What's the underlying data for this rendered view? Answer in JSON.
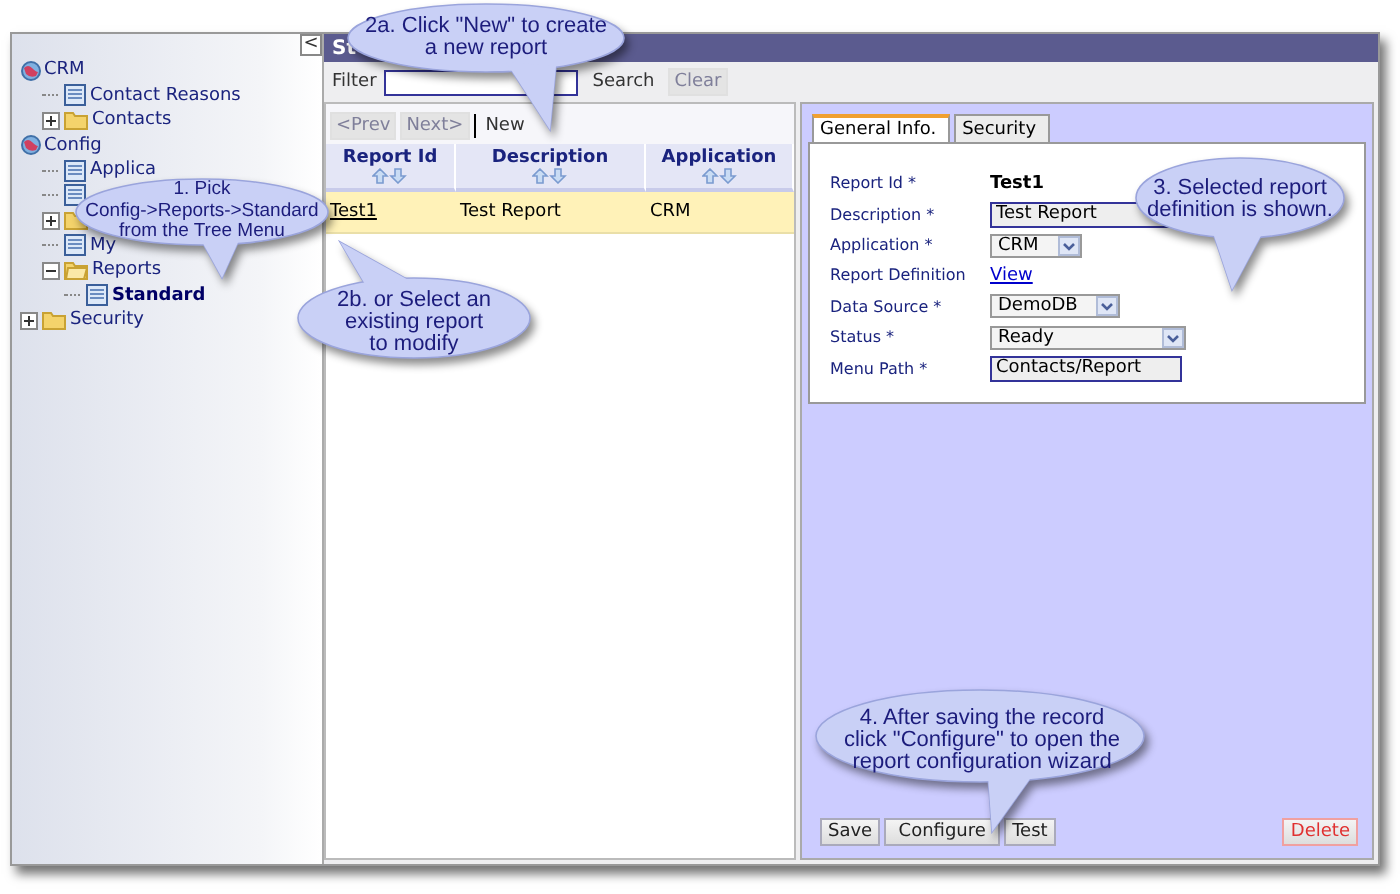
{
  "sidebar": {
    "collapse_button": "<",
    "tree": [
      {
        "label": "CRM",
        "kind": "globe",
        "selected": false,
        "children": [
          {
            "label": "Contact Reasons",
            "kind": "page",
            "selected": false
          },
          {
            "label": "Contacts",
            "kind": "folder",
            "expanded": false,
            "selected": false
          }
        ]
      },
      {
        "label": "Config",
        "kind": "globe",
        "selected": false,
        "children": [
          {
            "label": "Applica",
            "kind": "page",
            "selected": false
          },
          {
            "kind": "page"
          },
          {
            "kind": "folder",
            "expanded": false
          },
          {
            "label": "My",
            "kind": "page",
            "selected": false
          },
          {
            "label": "Reports",
            "kind": "folder",
            "expanded": true,
            "selected": false,
            "children": [
              {
                "label": "Standard",
                "kind": "page",
                "selected": true
              }
            ]
          }
        ]
      },
      {
        "label": "Security",
        "kind": "folder",
        "expanded": false,
        "selected": false
      }
    ]
  },
  "title": "St",
  "filter": {
    "label": "Filter",
    "search_button": "Search",
    "clear_button": {
      "label": "Clear",
      "disabled": true
    }
  },
  "list": {
    "pager": [
      {
        "label": "<Prev",
        "disabled": true
      },
      {
        "label": "Next>",
        "disabled": true
      },
      {
        "label": "New",
        "disabled": false
      }
    ],
    "columns": [
      "Report Id",
      "Description",
      "Application"
    ],
    "rows": [
      {
        "cells": [
          "Test1",
          "Test Report",
          "CRM"
        ],
        "selected": true
      }
    ]
  },
  "form": {
    "tabs": [
      {
        "label": "General Info.",
        "selected": true
      },
      {
        "label": "Security",
        "selected": false
      }
    ],
    "fields": [
      {
        "kind": "static",
        "label": "Report Id *",
        "value": "Test1"
      },
      {
        "kind": "text",
        "label": "Description *",
        "value": "Test Report"
      },
      {
        "kind": "select",
        "label": "Application *",
        "value": "CRM"
      },
      {
        "kind": "link",
        "label": "Report Definition",
        "value": "View"
      },
      {
        "kind": "select",
        "label": "Data Source *",
        "value": "DemoDB"
      },
      {
        "kind": "select",
        "label": "Status *",
        "value": "Ready"
      },
      {
        "kind": "text",
        "label": "Menu Path *",
        "value": "Contacts/Report"
      }
    ],
    "buttons": [
      {
        "label": "Save",
        "kind": "normal"
      },
      {
        "label": "Configure",
        "kind": "normal"
      },
      {
        "label": "Test",
        "kind": "normal"
      },
      {
        "label": "Delete",
        "kind": "danger"
      }
    ]
  },
  "callouts": [
    {
      "lines": [
        "1. Pick",
        "Config->Reports->Standard",
        "from the Tree Menu"
      ]
    },
    {
      "lines": [
        "2a. Click \"New\" to create",
        "a new report"
      ]
    },
    {
      "lines": [
        "2b. or Select an",
        "existing report",
        "to modify"
      ]
    },
    {
      "lines": [
        "3. Selected report",
        "definition is shown."
      ]
    },
    {
      "lines": [
        "4. After saving the record",
        "click \"Configure\" to open the",
        "report configuration wizard"
      ]
    }
  ]
}
